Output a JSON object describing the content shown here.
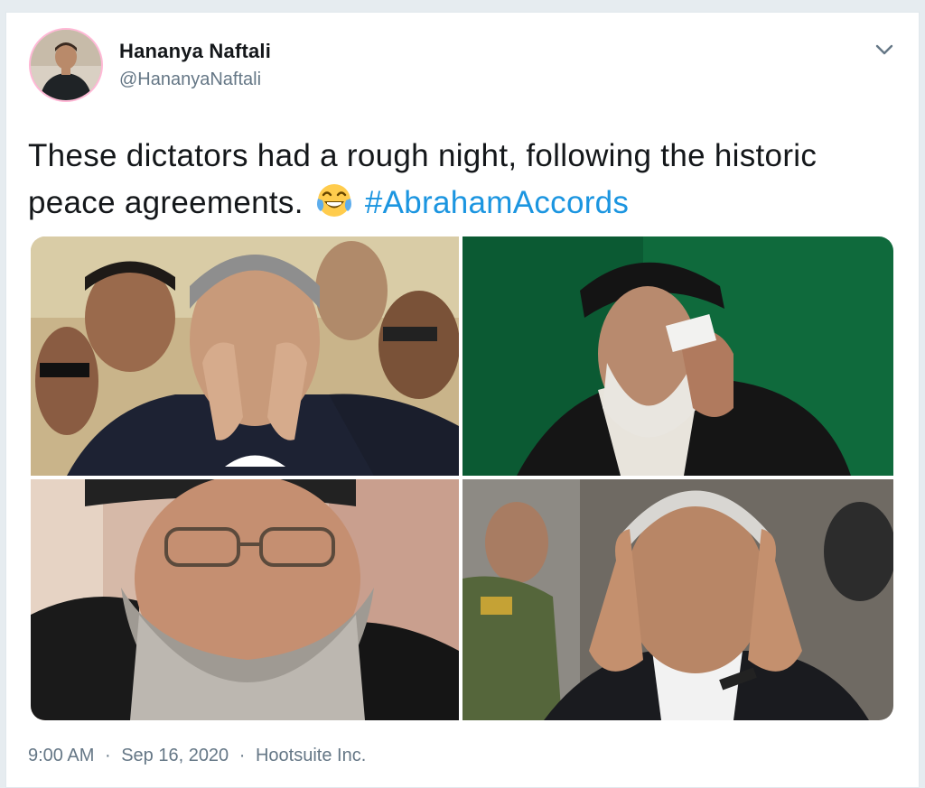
{
  "tweet": {
    "author": {
      "name": "Hananya Naftali",
      "handle": "@HananyaNaftali"
    },
    "text": {
      "line_main": "These dictators had a rough night, following the historic peace agreements.",
      "emoji": "face-with-tears-of-joy",
      "hashtag": "#AbrahamAccords"
    },
    "media": [
      {
        "subject": "photo-1"
      },
      {
        "subject": "photo-2"
      },
      {
        "subject": "photo-3"
      },
      {
        "subject": "photo-4"
      }
    ],
    "meta": {
      "time": "9:00 AM",
      "sep1": "·",
      "date": "Sep 16, 2020",
      "sep2": "·",
      "source": "Hootsuite Inc."
    }
  },
  "icons": {
    "caret": "chevron-down-icon",
    "emoji": "face-with-tears-of-joy-icon"
  },
  "colors": {
    "link": "#1b95e0",
    "text": "#14171a",
    "muted": "#657786",
    "border": "#e1e8ed"
  }
}
